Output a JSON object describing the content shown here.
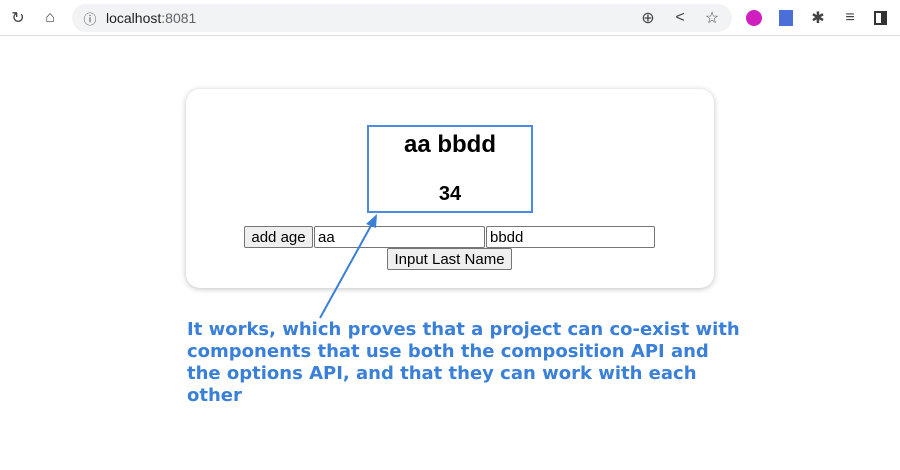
{
  "browser": {
    "url_host": "localhost",
    "url_port": ":8081",
    "icons": [
      "reload-icon",
      "home-icon",
      "info-icon",
      "zoom-icon",
      "share-icon",
      "star-icon",
      "extension-lr-icon",
      "translate-icon",
      "puzzle-icon",
      "reading-list-icon",
      "side-panel-icon"
    ]
  },
  "app": {
    "full_name": "aa bbdd",
    "age": "34",
    "add_age_label": "add age",
    "first_name_value": "aa",
    "last_name_value": "bbdd",
    "input_last_name_label": "Input Last Name"
  },
  "annotation": {
    "text": "It works, which proves that a project can co-exist with components that use both the composition API and the options API, and that they can work with each other",
    "color": "#3a7fd8"
  }
}
